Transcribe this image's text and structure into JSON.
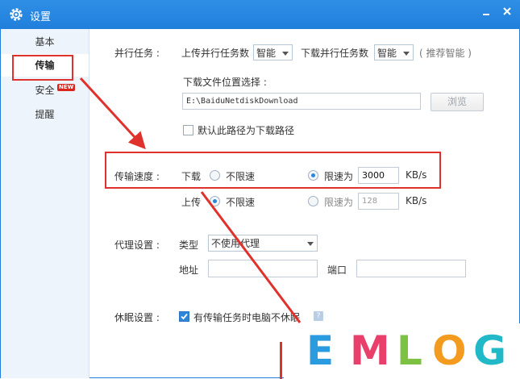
{
  "window": {
    "title": "设置",
    "gear_icon": "gear-icon"
  },
  "sidebar": {
    "items": [
      {
        "label": "基本"
      },
      {
        "label": "传输"
      },
      {
        "label": "安全",
        "badge": "NEW"
      },
      {
        "label": "提醒"
      }
    ],
    "active_index": 1
  },
  "parallel": {
    "label": "并行任务 :",
    "upload_label": "上传并行任务数",
    "upload_value": "智能",
    "download_label": "下载并行任务数",
    "download_value": "智能",
    "hint": "( 推荐智能 )"
  },
  "download_path": {
    "label": "下载文件位置选择 :",
    "value": "E:\\BaiduNetdiskDownload",
    "browse_label": "浏览",
    "default_checkbox_label": "默认此路径为下载路径",
    "default_checked": false
  },
  "speed": {
    "label": "传输速度 :",
    "download_label": "下载",
    "upload_label": "上传",
    "unlimited_label": "不限速",
    "limit_label": "限速为",
    "unit": "KB/s",
    "download_mode": "limit",
    "download_limit": "3000",
    "upload_mode": "unlimited",
    "upload_limit": "128"
  },
  "proxy": {
    "label": "代理设置 :",
    "type_label": "类型",
    "type_value": "不使用代理",
    "address_label": "地址",
    "port_label": "端口"
  },
  "sleep": {
    "label": "休眠设置 :",
    "checkbox_label": "有传输任务时电脑不休眠",
    "checked": true,
    "help_icon": "?"
  },
  "watermark": {
    "letters": [
      "E",
      "M",
      "L",
      "O",
      "G"
    ],
    "colors": [
      "#2b9be0",
      "#e8406a",
      "#7cc142",
      "#f39b1f",
      "#21b9c8"
    ]
  },
  "colors": {
    "accent": "#1f7fdb",
    "annotation": "#e0322c"
  }
}
